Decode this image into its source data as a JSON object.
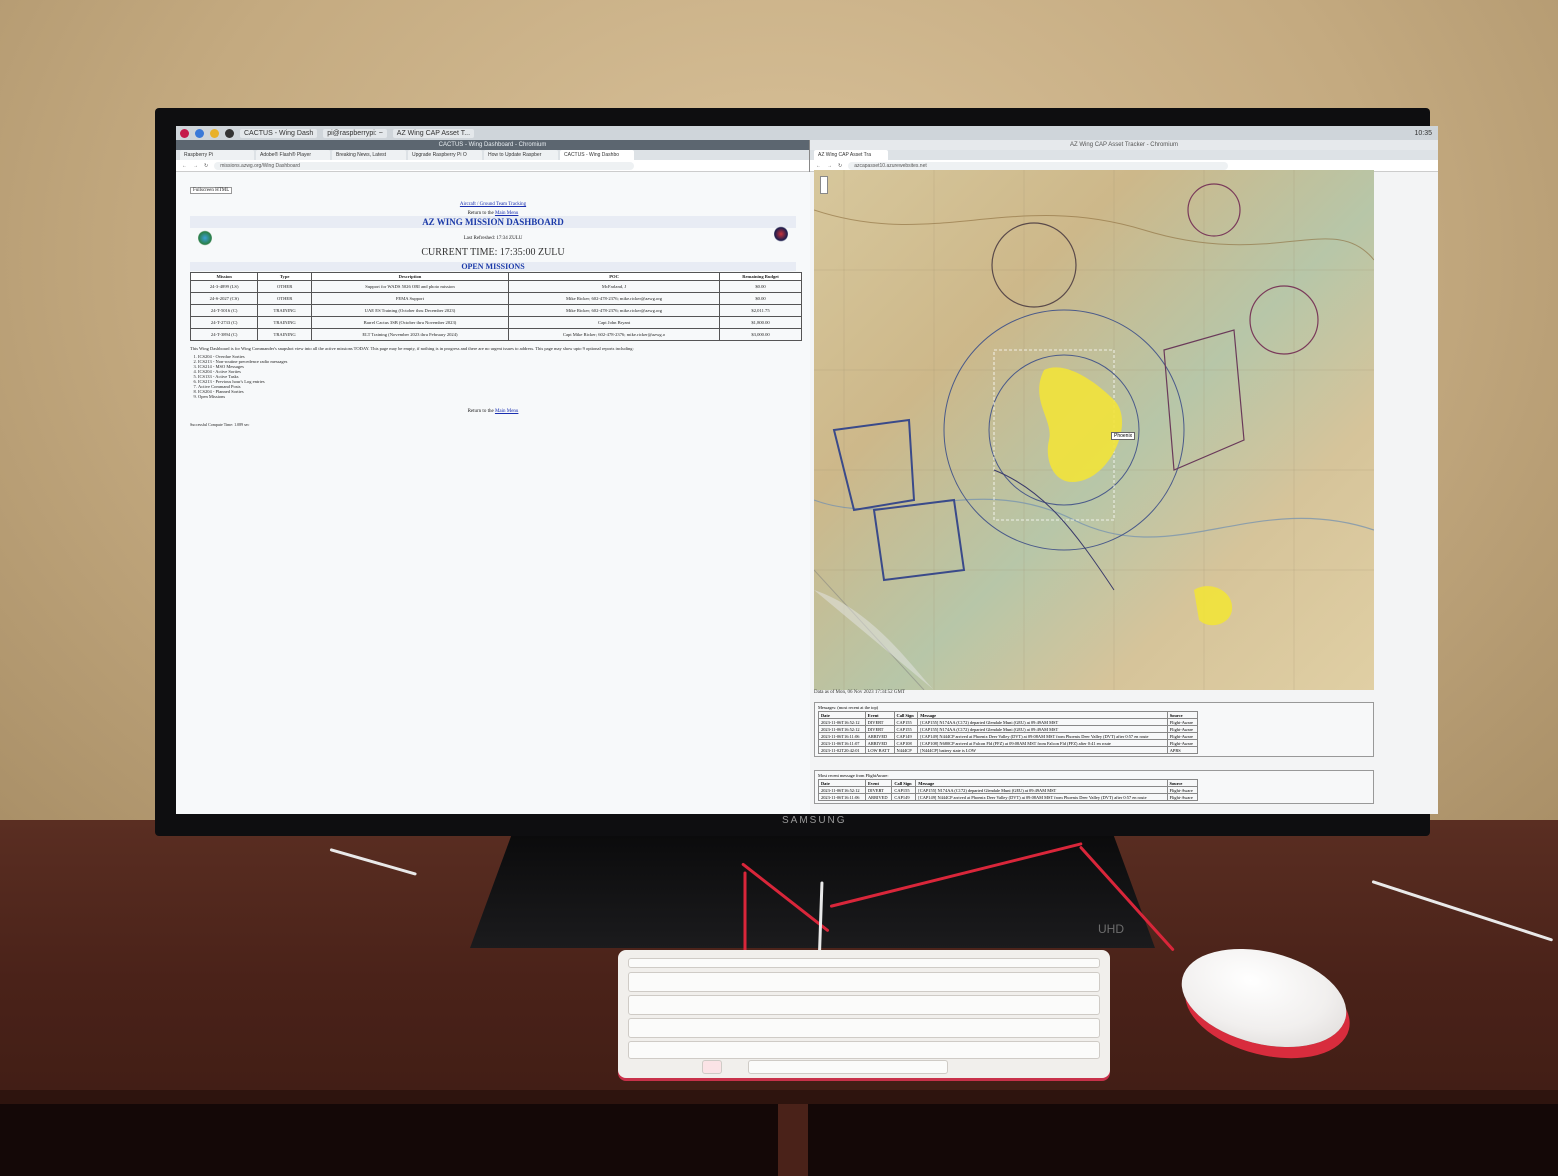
{
  "monitor": {
    "brand": "SAMSUNG",
    "badge": "UHD"
  },
  "taskbar": {
    "items": [
      "CACTUS - Wing Dash",
      "pi@raspberrypi: ~",
      "AZ Wing CAP Asset T..."
    ],
    "clock": "10:35"
  },
  "left_window": {
    "title": "CACTUS - Wing Dashboard - Chromium",
    "tabs": [
      "Raspberry Pi",
      "Adobe® Flash® Player",
      "Breaking News, Latest",
      "Upgrade Raspberry Pi O",
      "How to Update Raspber",
      "CACTUS - Wing Dashbo"
    ],
    "url": "missions.azwg.org/Wing Dashboard",
    "page": {
      "top_button": "Fullscreen HTML",
      "top_link": "Aircraft / Ground Team Tracking",
      "return_prefix": "Return to the",
      "return_link": "Main Menu",
      "heading": "AZ WING MISSION DASHBOARD",
      "last_refreshed": "Last Refreshed: 17:34 ZULU",
      "current_time": "CURRENT TIME: 17:35:00 ZULU",
      "open_missions_title": "OPEN MISSIONS",
      "table_headers": [
        "Mission",
        "Type",
        "Description",
        "POC",
        "Remaining Budget"
      ],
      "table_rows": [
        [
          "24-3-4899 (LS)",
          "OTHER",
          "Support for WADS 5026 ORI and photo mission",
          "McFarland, J",
          "$0.00"
        ],
        [
          "24-S-2027 (CS)",
          "OTHER",
          "FEMA Support",
          "Mike Ricker; 602-478-2376; mike.ricker@azwg.org",
          "$0.00"
        ],
        [
          "24-T-5016 (C)",
          "TRAINING",
          "UAE ES Training (October thru December 2023)",
          "Mike Ricker; 602-478-2376; mike.ricker@azwg.org",
          "$2,011.75"
        ],
        [
          "24-T-2733 (C)",
          "TRAINING",
          "Barrel Cactus 3SB (October thru November 2023)",
          "Capt John Bryant",
          "$1,800.00"
        ],
        [
          "24-T-3894 (C)",
          "TRAINING",
          "ELT Training (November 2023 thru February 2024)",
          "Capt Mike Ricker; 602-478-2376; mike.ricker@azwg.o",
          "$3,000.00"
        ]
      ],
      "description": "This Wing Dashboard is for Wing Commander's snapshot view into all the active missions TODAY. This page may be empty, if nothing is in progress and there are no urgent issues to address. This page may show upto 9 optional reports including:",
      "report_list": [
        "ICS204 - Overdue Sorties",
        "ICS213 - Non-routine precedence radio messages",
        "ICS214 - MSO Messages",
        "ICS204 - Active Sorties",
        "ICS133 - Active Tasks",
        "ICS213 - Previous hour's Log entries",
        "Active Command Posts",
        "ICS204 - Planned Sorties",
        "Open Missions"
      ],
      "footer_note": "Successful Compute Time: 1.089 sec"
    }
  },
  "right_window": {
    "title": "AZ Wing CAP Asset Tracker - Chromium",
    "tab": "AZ Wing CAP Asset Tra",
    "url": "azcapasset10.azurewebsites.net",
    "map_caption": "Data as of Mon, 06 Nov 2023 17:34:52 GMT",
    "map_label": "Phoenix",
    "messages_title": "Messages: (most recent at the top)",
    "messages_headers": [
      "Date",
      "Event",
      "Call Sign",
      "Message",
      "Source"
    ],
    "messages_rows": [
      [
        "2023-11-06T16:52:12",
        "DIVERT",
        "CAP155",
        "[CAP155] N174AA (C172) departed Glendale Muni (GEU) at 09:49AM MST",
        "Flight-Aware"
      ],
      [
        "2023-11-06T16:52:12",
        "DIVERT",
        "CAP155",
        "[CAP155] N174AA (C172) departed Glendale Muni (GEU) at 09:49AM MST",
        "Flight-Aware"
      ],
      [
        "2023-11-06T16:11:06",
        "ARRIVED",
        "CAP149",
        "[CAP149] N444CP arrived at Phoenix Deer Valley (DVT) at 09:08AM MST from Phoenix Deer Valley (DVT) after 0:57 en route",
        "Flight-Aware"
      ],
      [
        "2023-11-06T16:11:07",
        "ARRIVED",
        "CAP108",
        "[CAP108] N680CP arrived at Falcon Fld (FFZ) at 09:08AM MST from Falcon Fld (FFZ) after 0:41 en route",
        "Flight-Aware"
      ],
      [
        "2023-11-02T20:42:01",
        "LOW BATT",
        "N444CP",
        "[N444CP] battery state is LOW",
        "APRS"
      ]
    ],
    "fa_title": "Most recent message from FlightAware:",
    "fa_headers": [
      "Date",
      "Event",
      "Call Sign",
      "Message",
      "Source"
    ],
    "fa_rows": [
      [
        "2023-11-06T16:52:12",
        "DIVERT",
        "CAP155",
        "[CAP155] N174AA (C172) departed Glendale Muni (GEU) at 09:49AM MST",
        "Flight-Aware"
      ],
      [
        "2023-11-06T16:11:06",
        "ARRIVED",
        "CAP149",
        "[CAP149] N444CP arrived at Phoenix Deer Valley (DVT) at 09:08AM MST from Phoenix Deer Valley (DVT) after 0:57 en route",
        "Flight-Aware"
      ]
    ]
  },
  "colors": {
    "wall": "#c4aa80",
    "desk": "#4a2219",
    "accent_red": "#d9263a",
    "dashboard_heading": "#1b3aa8",
    "map_urban": "#f2e33a"
  }
}
